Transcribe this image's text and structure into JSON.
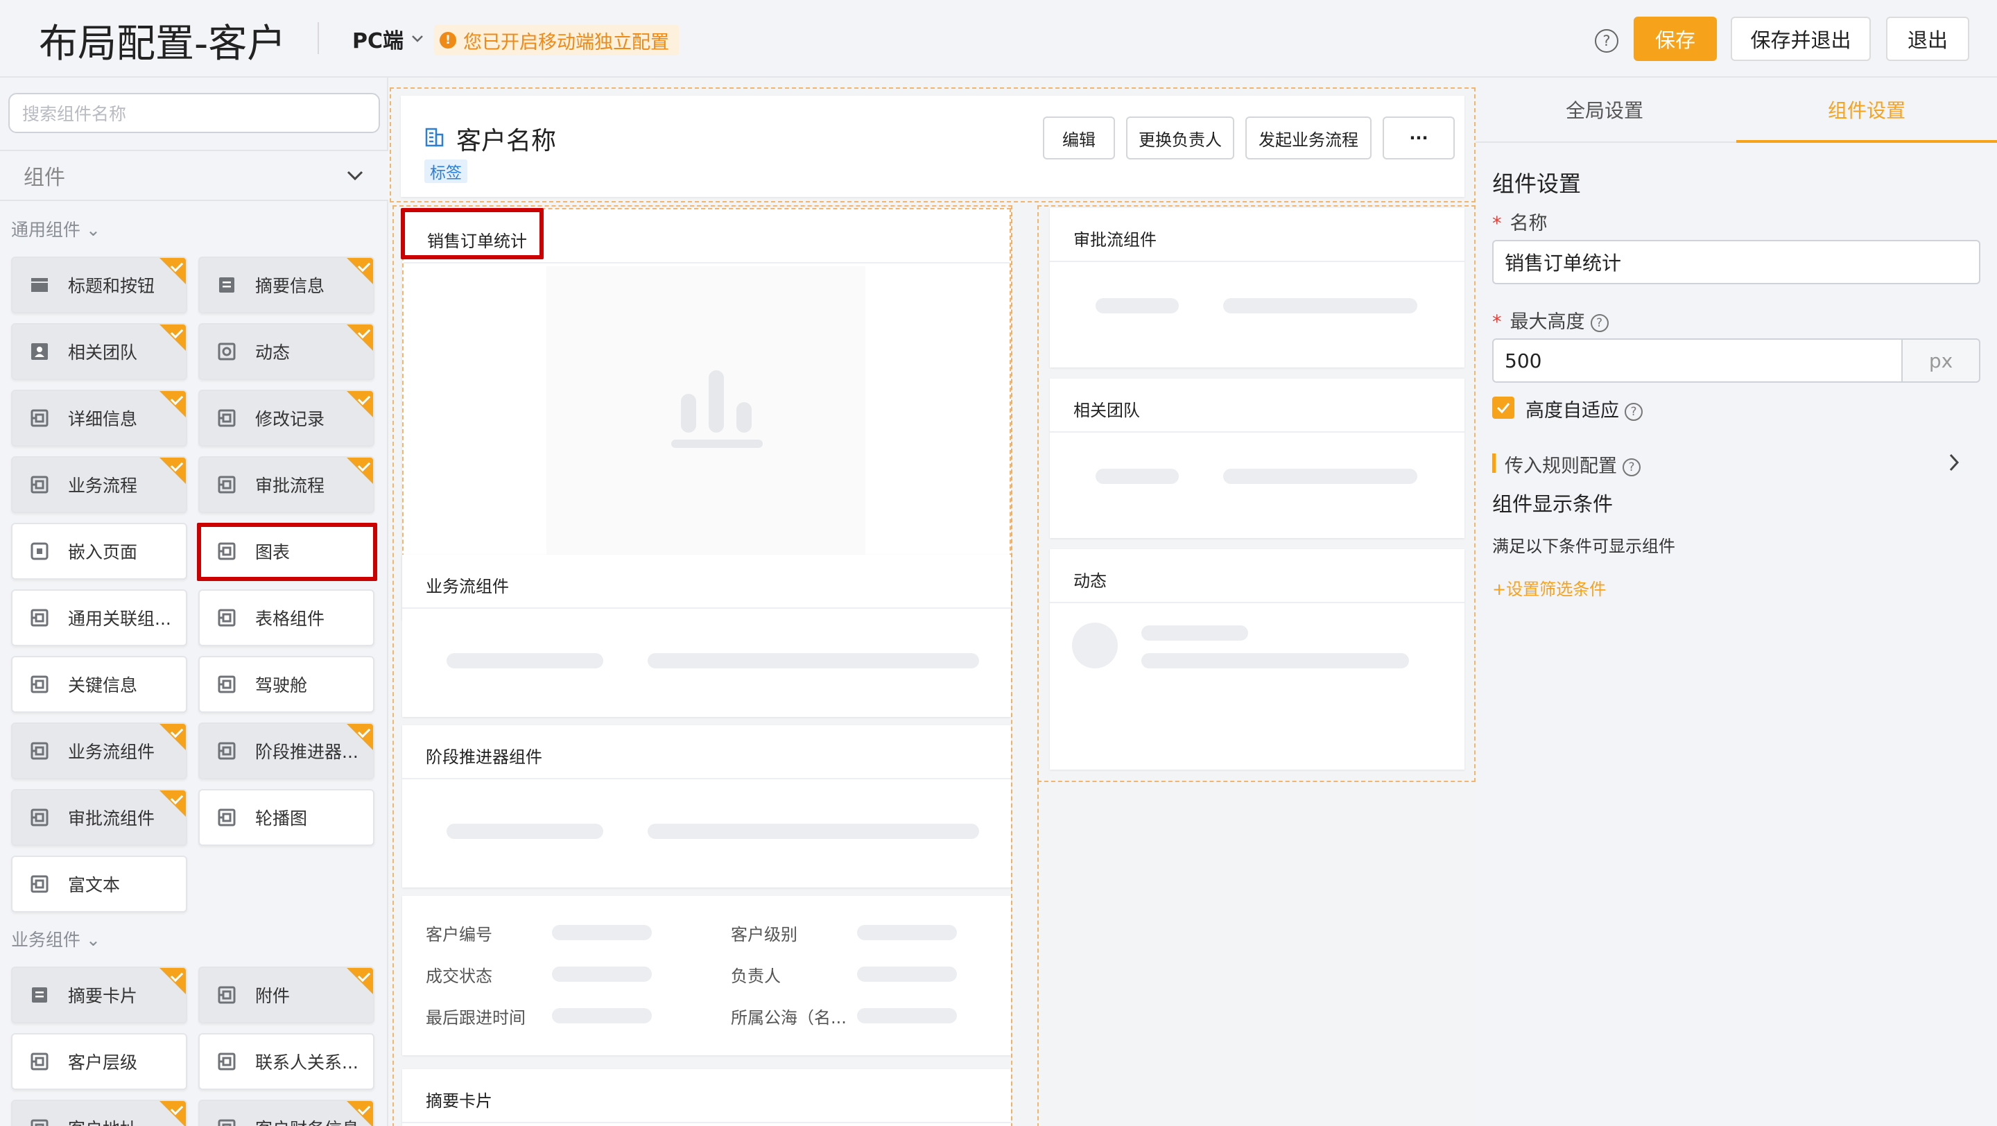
{
  "header": {
    "title": "布局配置-客户",
    "device": "PC端",
    "notice": "您已开启移动端独立配置",
    "help_icon": "question-circle-icon",
    "buttons": {
      "save": "保存",
      "save_exit": "保存并退出",
      "exit": "退出"
    }
  },
  "left": {
    "search_placeholder": "搜索组件名称",
    "select_value": "组件",
    "sections": {
      "common": "通用组件",
      "business": "业务组件"
    },
    "common_items": [
      {
        "label": "标题和按钮",
        "icon": "layout-icon",
        "flag": true
      },
      {
        "label": "摘要信息",
        "icon": "summary-icon",
        "flag": true
      },
      {
        "label": "相关团队",
        "icon": "team-icon",
        "flag": true
      },
      {
        "label": "动态",
        "icon": "feed-icon",
        "flag": true
      },
      {
        "label": "详细信息",
        "icon": "component-icon",
        "flag": true
      },
      {
        "label": "修改记录",
        "icon": "component-icon",
        "flag": true
      },
      {
        "label": "业务流程",
        "icon": "component-icon",
        "flag": true
      },
      {
        "label": "审批流程",
        "icon": "component-icon",
        "flag": true
      },
      {
        "label": "嵌入页面",
        "icon": "embed-icon",
        "flag": false
      },
      {
        "label": "图表",
        "icon": "component-icon",
        "flag": false
      },
      {
        "label": "通用关联组...",
        "icon": "component-icon",
        "flag": false
      },
      {
        "label": "表格组件",
        "icon": "component-icon",
        "flag": false
      },
      {
        "label": "关键信息",
        "icon": "component-icon",
        "flag": false
      },
      {
        "label": "驾驶舱",
        "icon": "component-icon",
        "flag": false
      },
      {
        "label": "业务流组件",
        "icon": "component-icon",
        "flag": true
      },
      {
        "label": "阶段推进器...",
        "icon": "component-icon",
        "flag": true
      },
      {
        "label": "审批流组件",
        "icon": "component-icon",
        "flag": true
      },
      {
        "label": "轮播图",
        "icon": "component-icon",
        "flag": false
      },
      {
        "label": "富文本",
        "icon": "component-icon",
        "flag": false
      }
    ],
    "business_items": [
      {
        "label": "摘要卡片",
        "icon": "summary-icon",
        "flag": true
      },
      {
        "label": "附件",
        "icon": "component-icon",
        "flag": true
      },
      {
        "label": "客户层级",
        "icon": "component-icon",
        "flag": false
      },
      {
        "label": "联系人关系...",
        "icon": "component-icon",
        "flag": false
      },
      {
        "label": "客户地址",
        "icon": "component-icon",
        "flag": true
      },
      {
        "label": "客户财务信息",
        "icon": "component-icon",
        "flag": true
      }
    ]
  },
  "center": {
    "record_title": "客户名称",
    "record_tag": "标签",
    "actions": {
      "edit": "编辑",
      "change_owner": "更换负责人",
      "start_flow": "发起业务流程",
      "more": "···"
    },
    "cards": {
      "sales_stats": "销售订单统计",
      "approval": "审批流组件",
      "team": "相关团队",
      "feed": "动态",
      "business_flow": "业务流组件",
      "stage": "阶段推进器组件",
      "summary_card": "摘要卡片"
    },
    "fields": {
      "customer_no": "客户编号",
      "customer_level": "客户级别",
      "deal_status": "成交状态",
      "owner": "负责人",
      "last_follow": "最后跟进时间",
      "public_pool": "所属公海（名..."
    }
  },
  "right": {
    "tabs": {
      "global": "全局设置",
      "component": "组件设置"
    },
    "section_title": "组件设置",
    "name_label": "名称",
    "name_value": "销售订单统计",
    "max_height_label": "最大高度",
    "max_height_value": "500",
    "unit": "px",
    "auto_height_label": "高度自适应",
    "auto_height_checked": true,
    "rule_config": "传入规则配置",
    "display_condition": "组件显示条件",
    "condition_desc": "满足以下条件可显示组件",
    "add_filter": "+设置筛选条件"
  },
  "colors": {
    "accent": "#f7a21b",
    "highlight_red": "#cc0000",
    "tag_blue": "#2b7fd6"
  }
}
